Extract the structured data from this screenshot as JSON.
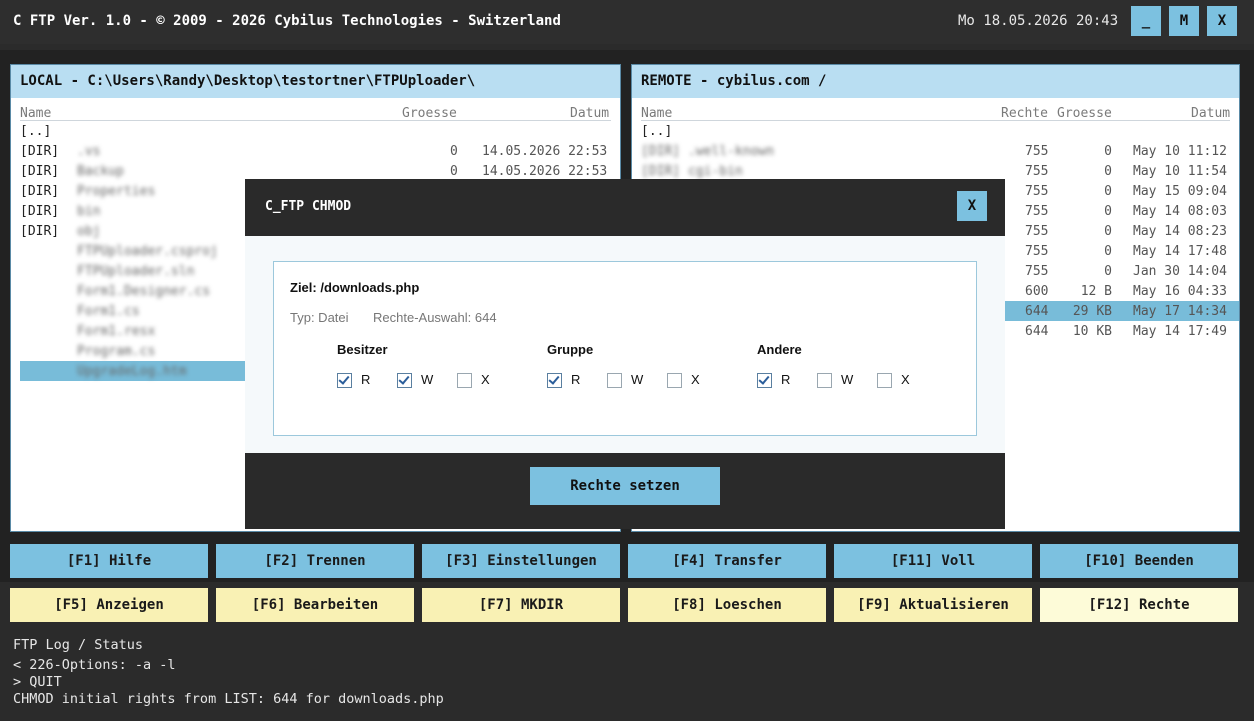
{
  "window": {
    "title": "C FTP Ver. 1.0 - © 2009 - 2026 Cybilus Technologies - Switzerland",
    "datetime": "Mo 18.05.2026  20:43",
    "btn_min": "_",
    "btn_max": "M",
    "btn_close": "X"
  },
  "local": {
    "header": "LOCAL - C:\\Users\\Randy\\Desktop\\testortner\\FTPUploader\\",
    "cols": {
      "name": "Name",
      "size": "Groesse",
      "date": "Datum"
    },
    "rows": [
      {
        "type": "[..]",
        "name": "",
        "size": "",
        "date": ""
      },
      {
        "type": "[DIR]",
        "name": ".vs",
        "size": "0",
        "date": "14.05.2026 22:53"
      },
      {
        "type": "[DIR]",
        "name": "Backup",
        "size": "0",
        "date": "14.05.2026 22:53"
      },
      {
        "type": "[DIR]",
        "name": "Properties",
        "size": "",
        "date": ""
      },
      {
        "type": "[DIR]",
        "name": "bin",
        "size": "",
        "date": ""
      },
      {
        "type": "[DIR]",
        "name": "obj",
        "size": "",
        "date": ""
      },
      {
        "type": "",
        "name": "FTPUploader.csproj",
        "size": "",
        "date": ""
      },
      {
        "type": "",
        "name": "FTPUploader.sln",
        "size": "",
        "date": ""
      },
      {
        "type": "",
        "name": "Form1.Designer.cs",
        "size": "",
        "date": ""
      },
      {
        "type": "",
        "name": "Form1.cs",
        "size": "",
        "date": ""
      },
      {
        "type": "",
        "name": "Form1.resx",
        "size": "",
        "date": ""
      },
      {
        "type": "",
        "name": "Program.cs",
        "size": "",
        "date": ""
      },
      {
        "type": "",
        "name": "UpgradeLog.htm",
        "size": "",
        "date": ""
      }
    ]
  },
  "remote": {
    "header": "REMOTE - cybilus.com  /",
    "cols": {
      "name": "Name",
      "rights": "Rechte",
      "size": "Groesse",
      "date": "Datum"
    },
    "rows": [
      {
        "name": "[..]",
        "rights": "",
        "size": "",
        "date": ""
      },
      {
        "name": "[DIR]  .well-known",
        "rights": "755",
        "size": "0",
        "date": "May 10 11:12"
      },
      {
        "name": "[DIR]  cgi-bin",
        "rights": "755",
        "size": "0",
        "date": "May 10 11:54"
      },
      {
        "name": "",
        "rights": "755",
        "size": "0",
        "date": "May 15 09:04"
      },
      {
        "name": "",
        "rights": "755",
        "size": "0",
        "date": "May 14 08:03"
      },
      {
        "name": "",
        "rights": "755",
        "size": "0",
        "date": "May 14 08:23"
      },
      {
        "name": "",
        "rights": "755",
        "size": "0",
        "date": "May 14 17:48"
      },
      {
        "name": "",
        "rights": "755",
        "size": "0",
        "date": "Jan 30 14:04"
      },
      {
        "name": "",
        "rights": "600",
        "size": "12 B",
        "date": "May 16 04:33"
      },
      {
        "name": "",
        "rights": "644",
        "size": "29 KB",
        "date": "May 17 14:34"
      },
      {
        "name": "",
        "rights": "644",
        "size": "10 KB",
        "date": "May 14 17:49"
      }
    ]
  },
  "fkeys_row1": [
    "[F1] Hilfe",
    "[F2] Trennen",
    "[F3] Einstellungen",
    "[F4] Transfer",
    "[F11] Voll",
    "[F10] Beenden"
  ],
  "fkeys_row2": [
    "[F5] Anzeigen",
    "[F6] Bearbeiten",
    "[F7] MKDIR",
    "[F8] Loeschen",
    "[F9] Aktualisieren",
    "[F12] Rechte"
  ],
  "log": {
    "title": "FTP Log / Status",
    "lines": [
      "< 226-Options: -a -l",
      "> QUIT",
      "CHMOD initial rights from LIST: 644 for downloads.php"
    ]
  },
  "chmod_dialog": {
    "title": "C_FTP CHMOD",
    "close": "X",
    "target": "Ziel: /downloads.php",
    "type": "Typ: Datei",
    "selection": "Rechte-Auswahl: 644",
    "groups": [
      {
        "label": "Besitzer",
        "perms": [
          {
            "k": "R",
            "on": true
          },
          {
            "k": "W",
            "on": true
          },
          {
            "k": "X",
            "on": false
          }
        ]
      },
      {
        "label": "Gruppe",
        "perms": [
          {
            "k": "R",
            "on": true
          },
          {
            "k": "W",
            "on": false
          },
          {
            "k": "X",
            "on": false
          }
        ]
      },
      {
        "label": "Andere",
        "perms": [
          {
            "k": "R",
            "on": true
          },
          {
            "k": "W",
            "on": false
          },
          {
            "k": "X",
            "on": false
          }
        ]
      }
    ],
    "submit": "Rechte setzen"
  },
  "colors": {
    "accent": "#7cc1e0",
    "header": "#b9def2",
    "yellow": "#f9f1b4",
    "selection": "#78bcd9"
  }
}
